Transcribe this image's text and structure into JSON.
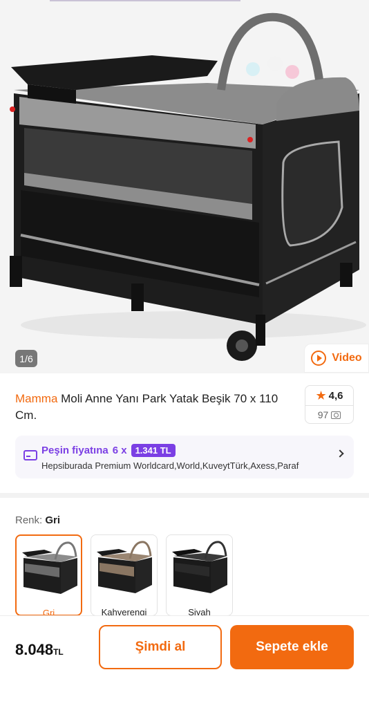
{
  "gallery": {
    "page_indicator": "1/6",
    "video_label": "Video"
  },
  "product": {
    "brand": "Mamma",
    "title": "Moli Anne Yanı Park Yatak Beşik 70 x 110 Cm."
  },
  "rating": {
    "score": "4,6",
    "photo_count": "97"
  },
  "installment": {
    "label": "Peşin fiyatına",
    "count": "6 x",
    "amount": "1.341 TL",
    "cards": "Hepsiburada Premium Worldcard,World,KuveytTürk,Axess,Paraf"
  },
  "color": {
    "label": "Renk:",
    "selected": "Gri",
    "options": [
      {
        "name": "Gri",
        "accent": "#6b6b6b"
      },
      {
        "name": "Kahverengi",
        "accent": "#8a7662"
      },
      {
        "name": "Siyah",
        "accent": "#2a2a2a"
      }
    ]
  },
  "purchase": {
    "price": "8.048",
    "currency": "TL",
    "buy_now": "Şimdi al",
    "add_to_cart": "Sepete ekle"
  },
  "colors": {
    "accent": "#f26a10",
    "purple": "#7b3fe4"
  }
}
